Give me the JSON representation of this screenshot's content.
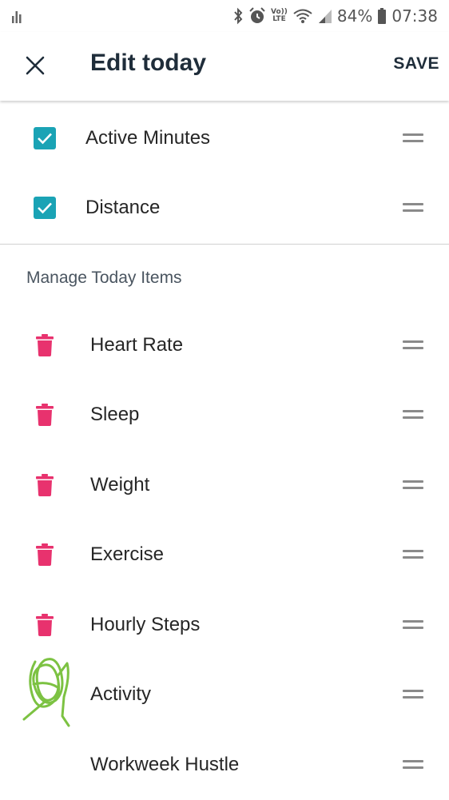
{
  "status_bar": {
    "battery": "84%",
    "time": "07:38",
    "volte_top": "Vo))",
    "volte_bottom": "LTE"
  },
  "app_bar": {
    "title": "Edit today",
    "save_label": "SAVE"
  },
  "enabled_items": [
    {
      "label": "Active Minutes",
      "checked": true
    },
    {
      "label": "Distance",
      "checked": true
    }
  ],
  "manage_section": {
    "header": "Manage Today Items",
    "items": [
      {
        "label": "Heart Rate",
        "icon": "trash-icon"
      },
      {
        "label": "Sleep",
        "icon": "trash-icon"
      },
      {
        "label": "Weight",
        "icon": "trash-icon"
      },
      {
        "label": "Exercise",
        "icon": "trash-icon"
      },
      {
        "label": "Hourly Steps",
        "icon": "trash-icon"
      },
      {
        "label": "Activity",
        "icon": "scribble-icon"
      },
      {
        "label": "Workweek Hustle",
        "icon": "none"
      }
    ]
  },
  "colors": {
    "checkbox": "#1aa3b5",
    "trash": "#e8326e",
    "title": "#1f2d3a",
    "scribble": "#7cc242"
  }
}
